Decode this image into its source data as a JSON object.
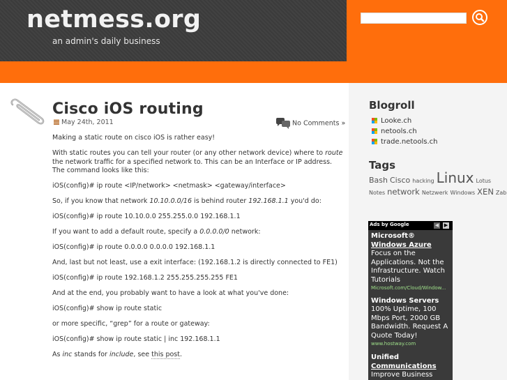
{
  "site": {
    "title": "netmess.org",
    "tagline": "an admin's daily business",
    "search_placeholder": ""
  },
  "colors": {
    "accent": "#ff6e0c",
    "header_bg": "#3f3f3f",
    "sidebar_bg": "#f4f4f4",
    "ad_bg": "#3a3a3a"
  },
  "post": {
    "title": "Cisco iOS routing",
    "date": "May 24th, 2011",
    "comments": "No Comments »",
    "p1": "Making a static route on cisco iOS is rather easy!",
    "p2a": "With static routes you can tell your router (or any other network device) where to ",
    "p2b": "route",
    "p2c": " the network traffic for a specified network to. This can be an Interface or IP address. The command looks like this:",
    "p3": "iOS(config)# ip route <IP/network> <netmask> <gateway/interface>",
    "p4a": "So, if you know that network ",
    "p4b": "10.10.0.0/16",
    "p4c": " is behind router ",
    "p4d": "192.168.1.1",
    "p4e": " you'd do:",
    "p5": "iOS(config)# ip route 10.10.0.0 255.255.0.0 192.168.1.1",
    "p6a": "If you want to add a default route, specify a ",
    "p6b": "0.0.0.0/0",
    "p6c": " network:",
    "p7": "iOS(config)# ip route 0.0.0.0 0.0.0.0 192.168.1.1",
    "p8": "And, last but not least, use a exit interface: (192.168.1.2 is directly connected to FE1)",
    "p9": "iOS(config)# ip route 192.168.1.2 255.255.255.255 FE1",
    "p10": "And at the end, you probably want to have a look at what you've done:",
    "p11": "iOS(config)# show ip route static",
    "p12": "or more specific, “grep” for a route or gateway:",
    "p13": "iOS(config)# show ip route static | inc 192.168.1.1",
    "p14a": "As ",
    "p14b": "inc",
    "p14c": " stands for ",
    "p14d": "include",
    "p14e": ", see ",
    "p14f": "this post",
    "p14g": "."
  },
  "sidebar": {
    "blogroll_heading": "Blogroll",
    "blogroll": [
      "Looke.ch",
      "netools.ch",
      "trade.netools.ch"
    ],
    "tags_heading": "Tags",
    "tags": [
      "Bash",
      "Cisco",
      "hacking",
      "Linux",
      "Lotus Notes",
      "network",
      "Netzwerk",
      "Windows",
      "XEN",
      "Zabbix"
    ]
  },
  "ad": {
    "header": "Ads by Google",
    "prev_icon": "chevron-left-icon",
    "next_icon": "chevron-right-icon",
    "ad1_title1": "Microsoft®",
    "ad1_title2": "Windows Azure",
    "ad1_text": "Focus on the Applications. Not the Infrastructure. Watch Tutorials",
    "ad1_url": "Microsoft.com/Cloud/Window...",
    "ad2_title": "Windows Servers",
    "ad2_text": "100% Uptime, 100 Mbps Port, 2000 GB Bandwidth. Request A Quote Today!",
    "ad2_url": "www.hostway.com",
    "ad3_title1": "Unified",
    "ad3_title2": "Communications",
    "ad3_text": "Improve Business"
  }
}
